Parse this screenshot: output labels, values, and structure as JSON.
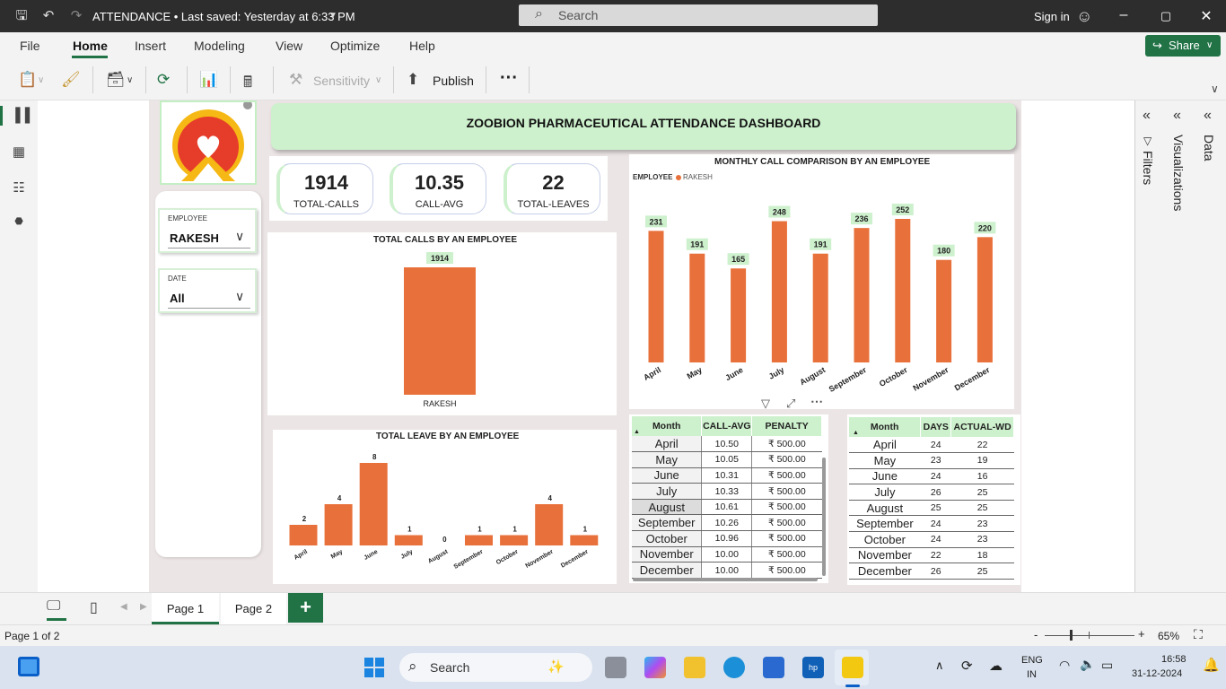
{
  "window": {
    "title": "ATTENDANCE • Last saved: Yesterday at 6:33 PM",
    "search_placeholder": "Search",
    "signin": "Sign in"
  },
  "menu": {
    "items": [
      "File",
      "Home",
      "Insert",
      "Modeling",
      "View",
      "Optimize",
      "Help"
    ],
    "active": "Home",
    "share": "Share"
  },
  "ribbon": {
    "sensitivity": "Sensitivity",
    "publish": "Publish",
    "more": "···"
  },
  "dashboard": {
    "title": "ZOOBION PHARMACEUTICAL ATTENDANCE DASHBOARD",
    "kpis": [
      {
        "value": "1914",
        "label": "TOTAL-CALLS"
      },
      {
        "value": "10.35",
        "label": "CALL-AVG"
      },
      {
        "value": "22",
        "label": "TOTAL-LEAVES"
      }
    ],
    "slicers": {
      "employee": {
        "title": "EMPLOYEE",
        "value": "RAKESH"
      },
      "date": {
        "title": "DATE",
        "value": "All"
      }
    },
    "table1": {
      "headers": [
        "Month",
        "CALL-AVG",
        "PENALTY"
      ],
      "rows": [
        [
          "April",
          "10.50",
          "₹ 500.00"
        ],
        [
          "May",
          "10.05",
          "₹ 500.00"
        ],
        [
          "June",
          "10.31",
          "₹ 500.00"
        ],
        [
          "July",
          "10.33",
          "₹ 500.00"
        ],
        [
          "August",
          "10.61",
          "₹ 500.00"
        ],
        [
          "September",
          "10.26",
          "₹ 500.00"
        ],
        [
          "October",
          "10.96",
          "₹ 500.00"
        ],
        [
          "November",
          "10.00",
          "₹ 500.00"
        ],
        [
          "December",
          "10.00",
          "₹ 500.00"
        ]
      ]
    },
    "table2": {
      "headers": [
        "Month",
        "DAYS",
        "ACTUAL-WD"
      ],
      "rows": [
        [
          "April",
          "24",
          "22"
        ],
        [
          "May",
          "23",
          "19"
        ],
        [
          "June",
          "24",
          "16"
        ],
        [
          "July",
          "26",
          "25"
        ],
        [
          "August",
          "25",
          "25"
        ],
        [
          "September",
          "24",
          "23"
        ],
        [
          "October",
          "24",
          "23"
        ],
        [
          "November",
          "22",
          "18"
        ],
        [
          "December",
          "26",
          "25"
        ]
      ]
    }
  },
  "chart_data": [
    {
      "type": "bar",
      "title": "TOTAL CALLS BY AN EMPLOYEE",
      "categories": [
        "RAKESH"
      ],
      "values": [
        1914
      ],
      "color": "#e8703a"
    },
    {
      "type": "bar",
      "title": "MONTHLY CALL COMPARISON BY AN EMPLOYEE",
      "legend_title": "EMPLOYEE",
      "legend": [
        "RAKESH"
      ],
      "categories": [
        "April",
        "May",
        "June",
        "July",
        "August",
        "September",
        "October",
        "November",
        "December"
      ],
      "values": [
        231,
        191,
        165,
        248,
        191,
        236,
        252,
        180,
        220
      ],
      "color": "#e8703a",
      "label_bg": "#cdf0cd"
    },
    {
      "type": "bar",
      "title": "TOTAL LEAVE BY AN EMPLOYEE",
      "categories": [
        "April",
        "May",
        "June",
        "July",
        "August",
        "September",
        "October",
        "November",
        "December"
      ],
      "values": [
        2,
        4,
        8,
        1,
        0,
        1,
        1,
        4,
        1
      ],
      "color": "#e8703a"
    }
  ],
  "pages": {
    "tabs": [
      "Page 1",
      "Page 2"
    ],
    "add": "+",
    "status": "Page 1 of 2",
    "zoom": "65%"
  },
  "panes": {
    "filters": "Filters",
    "visualizations": "Visualizations",
    "data": "Data"
  },
  "taskbar": {
    "search": "Search",
    "lang1": "ENG",
    "lang2": "IN",
    "time": "16:58",
    "date": "31-12-2024"
  }
}
